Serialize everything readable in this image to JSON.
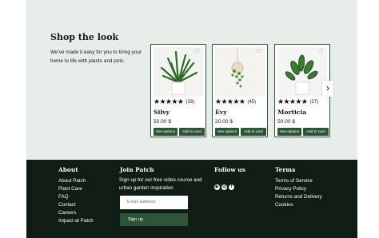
{
  "shop": {
    "title": "Shop the look",
    "text": "We've made it easy for you to bring your home to life with plants and pots."
  },
  "products": [
    {
      "name": "Silvy",
      "price": "50.00 $",
      "rating": "★★★★★",
      "count": "(33)",
      "options_label": "See options",
      "add_label": "Add to card"
    },
    {
      "name": "Evy",
      "price": "20.00 $",
      "rating": "★★★★★",
      "count": "(45)",
      "options_label": "See options",
      "add_label": "Add to card"
    },
    {
      "name": "Morticia",
      "price": "50.00 $",
      "rating": "★★★★★",
      "count": "(27)",
      "options_label": "See options",
      "add_label": "Add to card"
    }
  ],
  "icons": {
    "heart": "♡",
    "next": "›"
  },
  "footer": {
    "about": {
      "title": "About",
      "links": [
        "About Patch",
        "Plant Care",
        "FAQ",
        "Contact",
        "Careers",
        "Impact at Patch"
      ]
    },
    "join": {
      "title": "Join Patch",
      "text": "Sign up for our free video course and urban garden inspiration",
      "placeholder": "Email address",
      "button": "Sign up"
    },
    "follow": {
      "title": "Follow us",
      "icons": [
        "youtube-icon",
        "instagram-icon",
        "facebook-icon"
      ],
      "glyphs": [
        "▶",
        "◎",
        "f"
      ]
    },
    "terms": {
      "title": "Terms",
      "links": [
        "Terms of Service",
        "Privacy Policy",
        "Returns and Delivery",
        "Cookies"
      ]
    }
  },
  "colors": {
    "shop_bg": "#e7ede8",
    "accent": "#2f5338",
    "footer_bg": "#0f1d14",
    "heart": "#d54b84"
  }
}
